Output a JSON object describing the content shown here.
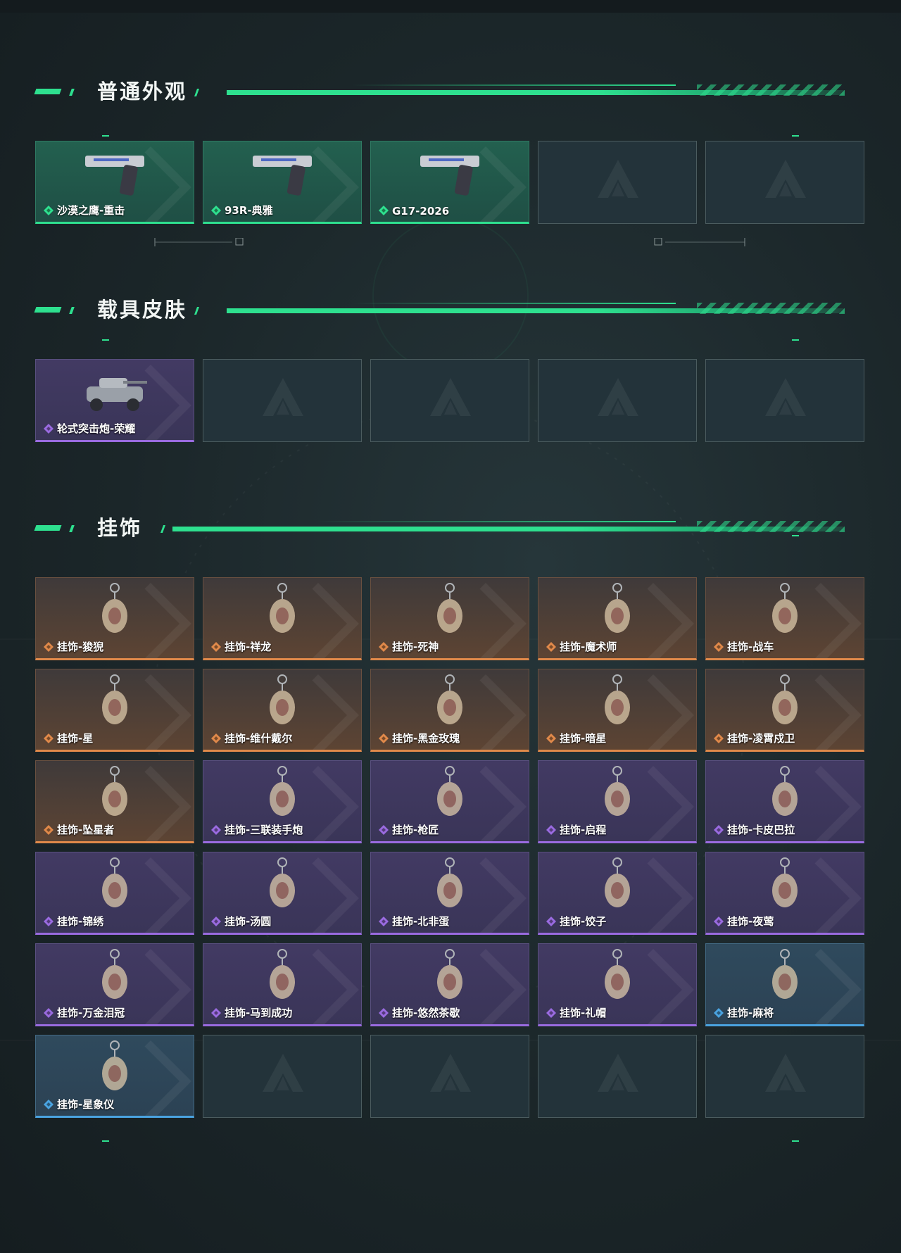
{
  "sections": [
    {
      "title": "普通外观",
      "items": [
        {
          "label": "沙漠之鹰-重击",
          "rarity": "green",
          "icon": "desert-eagle-pistol-icon"
        },
        {
          "label": "93R-典雅",
          "rarity": "green",
          "icon": "93r-pistol-icon"
        },
        {
          "label": "G17-2026",
          "rarity": "green",
          "icon": "g17-pistol-icon"
        },
        {
          "label": "",
          "rarity": "empty"
        },
        {
          "label": "",
          "rarity": "empty"
        }
      ]
    },
    {
      "title": "载具皮肤",
      "items": [
        {
          "label": "轮式突击炮-荣耀",
          "rarity": "purple",
          "icon": "armored-vehicle-icon"
        },
        {
          "label": "",
          "rarity": "empty"
        },
        {
          "label": "",
          "rarity": "empty"
        },
        {
          "label": "",
          "rarity": "empty"
        },
        {
          "label": "",
          "rarity": "empty"
        }
      ]
    },
    {
      "title": "挂饰",
      "items": [
        {
          "label": "挂饰-狻猊",
          "rarity": "orange",
          "icon": "charm-icon"
        },
        {
          "label": "挂饰-祥龙",
          "rarity": "orange",
          "icon": "charm-icon"
        },
        {
          "label": "挂饰-死神",
          "rarity": "orange",
          "icon": "charm-icon"
        },
        {
          "label": "挂饰-魔术师",
          "rarity": "orange",
          "icon": "charm-icon"
        },
        {
          "label": "挂饰-战车",
          "rarity": "orange",
          "icon": "charm-icon"
        },
        {
          "label": "挂饰-星",
          "rarity": "orange",
          "icon": "charm-icon"
        },
        {
          "label": "挂饰-维什戴尔",
          "rarity": "orange",
          "icon": "charm-icon"
        },
        {
          "label": "挂饰-黑金玫瑰",
          "rarity": "orange",
          "icon": "charm-icon"
        },
        {
          "label": "挂饰-暗星",
          "rarity": "orange",
          "icon": "charm-icon"
        },
        {
          "label": "挂饰-凌霄戍卫",
          "rarity": "orange",
          "icon": "charm-icon"
        },
        {
          "label": "挂饰-坠星者",
          "rarity": "orange",
          "icon": "charm-icon"
        },
        {
          "label": "挂饰-三联装手炮",
          "rarity": "purple",
          "icon": "charm-icon"
        },
        {
          "label": "挂饰-枪匠",
          "rarity": "purple",
          "icon": "charm-icon"
        },
        {
          "label": "挂饰-启程",
          "rarity": "purple",
          "icon": "charm-icon"
        },
        {
          "label": "挂饰-卡皮巴拉",
          "rarity": "purple",
          "icon": "charm-icon"
        },
        {
          "label": "挂饰-锦绣",
          "rarity": "purple",
          "icon": "charm-icon"
        },
        {
          "label": "挂饰-汤圆",
          "rarity": "purple",
          "icon": "charm-icon"
        },
        {
          "label": "挂饰-北非蛋",
          "rarity": "purple",
          "icon": "charm-icon"
        },
        {
          "label": "挂饰-饺子",
          "rarity": "purple",
          "icon": "charm-icon"
        },
        {
          "label": "挂饰-夜莺",
          "rarity": "purple",
          "icon": "charm-icon"
        },
        {
          "label": "挂饰-万金泪冠",
          "rarity": "purple",
          "icon": "charm-icon"
        },
        {
          "label": "挂饰-马到成功",
          "rarity": "purple",
          "icon": "charm-icon"
        },
        {
          "label": "挂饰-悠然茶歇",
          "rarity": "purple",
          "icon": "charm-icon"
        },
        {
          "label": "挂饰-礼帽",
          "rarity": "purple",
          "icon": "charm-icon"
        },
        {
          "label": "挂饰-麻将",
          "rarity": "blue",
          "icon": "charm-icon"
        },
        {
          "label": "挂饰-星象仪",
          "rarity": "blue",
          "icon": "charm-icon"
        },
        {
          "label": "",
          "rarity": "empty"
        },
        {
          "label": "",
          "rarity": "empty"
        },
        {
          "label": "",
          "rarity": "empty"
        },
        {
          "label": "",
          "rarity": "empty"
        }
      ]
    }
  ],
  "colors": {
    "accent": "#2ee08f",
    "green": "#2ee08f",
    "purple": "#9a6be0",
    "orange": "#e0894a",
    "blue": "#4aa3e0"
  }
}
